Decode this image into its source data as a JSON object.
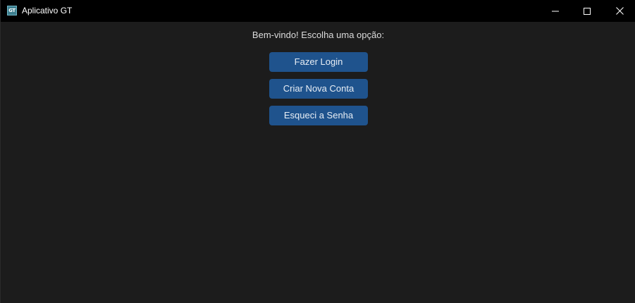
{
  "window": {
    "title": "Aplicativo GT",
    "icon_text": "GT",
    "icon": "app-gt-icon",
    "controls": {
      "minimize": "minimize-icon",
      "maximize": "maximize-icon",
      "close": "close-icon"
    }
  },
  "main": {
    "welcome_text": "Bem-vindo! Escolha uma opção:",
    "buttons": {
      "login": "Fazer Login",
      "create_account": "Criar Nova Conta",
      "forgot_password": "Esqueci a Senha"
    }
  },
  "colors": {
    "background": "#1c1c1c",
    "titlebar": "#000000",
    "button": "#1f538d",
    "button_text": "#e8eef5",
    "text": "#dcdcdc"
  }
}
